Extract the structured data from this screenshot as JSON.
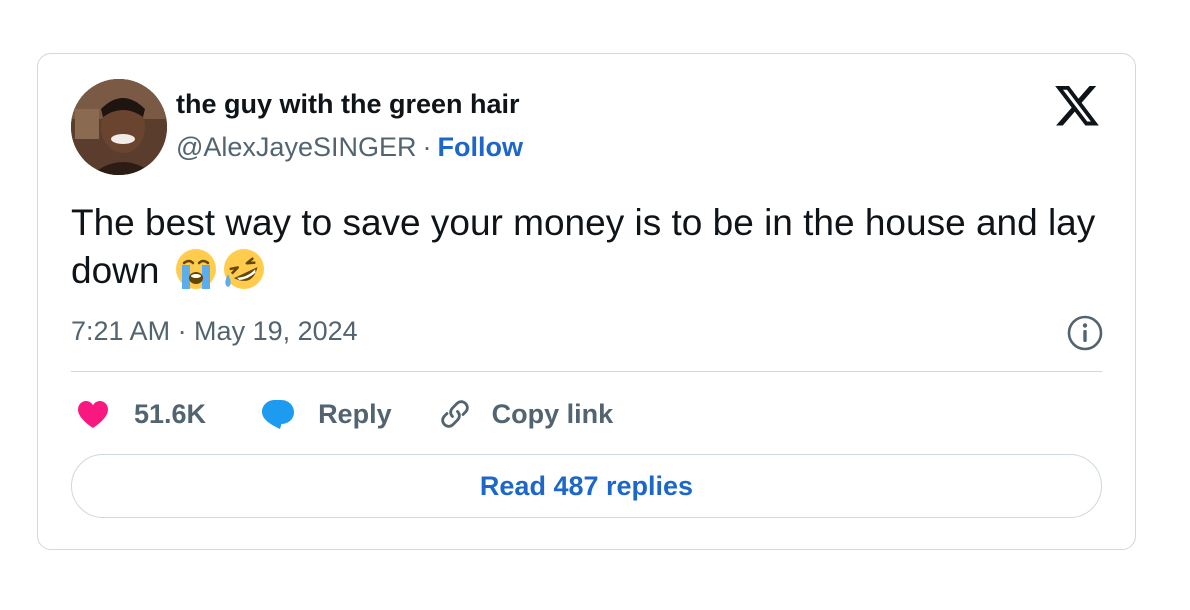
{
  "tweet": {
    "author": {
      "display_name": "the guy with the green hair",
      "handle": "@AlexJayeSINGER",
      "separator": "·",
      "follow_label": "Follow"
    },
    "text": "The best way to save your money is to be in the house and lay down",
    "emojis": [
      "loudly-crying-face-emoji",
      "rolling-on-floor-laughing-emoji"
    ],
    "timestamp": "7:21 AM · May 19, 2024",
    "actions": {
      "likes_count": "51.6K",
      "reply_label": "Reply",
      "copy_link_label": "Copy link"
    },
    "read_replies_label": "Read 487 replies"
  },
  "icons": {
    "brand": "x-logo-icon",
    "info": "info-icon",
    "like": "heart-icon",
    "reply": "speech-bubble-icon",
    "copy": "link-icon"
  },
  "colors": {
    "link_blue": "#1d67c9",
    "muted_text": "#536471",
    "heart": "#f91880",
    "reply_bubble": "#1d9bf0",
    "border": "#cfd9de"
  }
}
